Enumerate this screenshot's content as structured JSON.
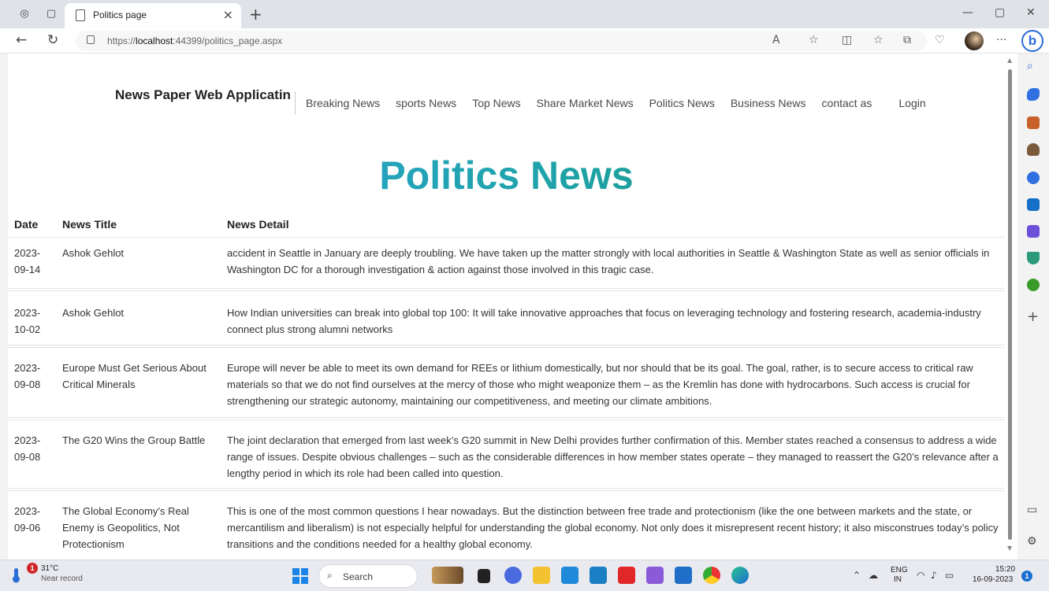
{
  "browser": {
    "tab_title": "Politics page",
    "url_prefix": "https://",
    "url_host": "localhost",
    "url_rest": ":44399/politics_page.aspx"
  },
  "site": {
    "brand": "News Paper Web Applicatin",
    "nav": [
      "Breaking News",
      "sports News",
      "Top News",
      "Share Market News",
      "Politics News",
      "Business News",
      "contact as"
    ],
    "login": "Login",
    "heading": "Politics News",
    "heading_colors": [
      "#2ea3e6",
      "#1fa3a8",
      "#0f8a6a"
    ]
  },
  "table": {
    "headers": {
      "date": "Date",
      "title": "News Title",
      "detail": "News Detail"
    },
    "rows": [
      {
        "date": "2023-09-14",
        "title": "Ashok Gehlot",
        "detail": "accident in Seattle in January are deeply troubling. We have taken up the matter strongly with local authorities in Seattle & Washington State as well as senior officials in Washington DC for a thorough investigation & action against those involved in this tragic case."
      },
      {
        "date": "2023-10-02",
        "title": "Ashok Gehlot",
        "detail": "How Indian universities can break into global top 100: It will take innovative approaches that focus on leveraging technology and fostering research, academia-industry connect plus strong alumni networks"
      },
      {
        "date": "2023-09-08",
        "title": "Europe Must Get Serious About Critical Minerals",
        "detail": "Europe will never be able to meet its own demand for REEs or lithium domestically, but nor should that be its goal. The goal, rather, is to secure access to critical raw materials so that we do not find ourselves at the mercy of those who might weaponize them – as the Kremlin has done with hydrocarbons. Such access is crucial for strengthening our strategic autonomy, maintaining our competitiveness, and meeting our climate ambitions."
      },
      {
        "date": "2023-09-08",
        "title": "The G20 Wins the Group Battle",
        "detail": "The joint declaration that emerged from last week’s G20 summit in New Delhi provides further confirmation of this. Member states reached a consensus to address a wide range of issues. Despite obvious challenges – such as the considerable differences in how member states operate – they managed to reassert the G20’s relevance after a lengthy period in which its role had been called into question."
      },
      {
        "date": "2023-09-06",
        "title": "The Global Economy’s Real Enemy is Geopolitics, Not Protectionism",
        "detail": "This is one of the most common questions I hear nowadays. But the distinction between free trade and protectionism (like the one between markets and the state, or mercantilism and liberalism) is not especially helpful for understanding the global economy. Not only does it misrepresent recent history; it also misconstrues today’s policy transitions and the conditions needed for a healthy global economy."
      }
    ]
  },
  "taskbar": {
    "weather_badge": "1",
    "temperature": "31°C",
    "weather_text": "Near record",
    "search_label": "Search",
    "lang_line1": "ENG",
    "lang_line2": "IN",
    "time": "15:20",
    "date": "16-09-2023",
    "notification_count": "1"
  },
  "icons": {
    "tab_actions": "tab-actions-icon",
    "tab_view": "vertical-tabs-icon",
    "page": "page-icon",
    "close": "close-icon",
    "new_tab": "plus-icon",
    "back": "back-arrow-icon",
    "refresh": "refresh-icon",
    "lock": "lock-icon",
    "read_aloud": "read-aloud-icon",
    "favorite": "star-icon",
    "split_screen": "split-screen-icon",
    "favorites": "favorites-icon",
    "collections": "collections-icon",
    "heart": "health-icon",
    "more": "more-icon",
    "copilot": "bing-icon"
  }
}
